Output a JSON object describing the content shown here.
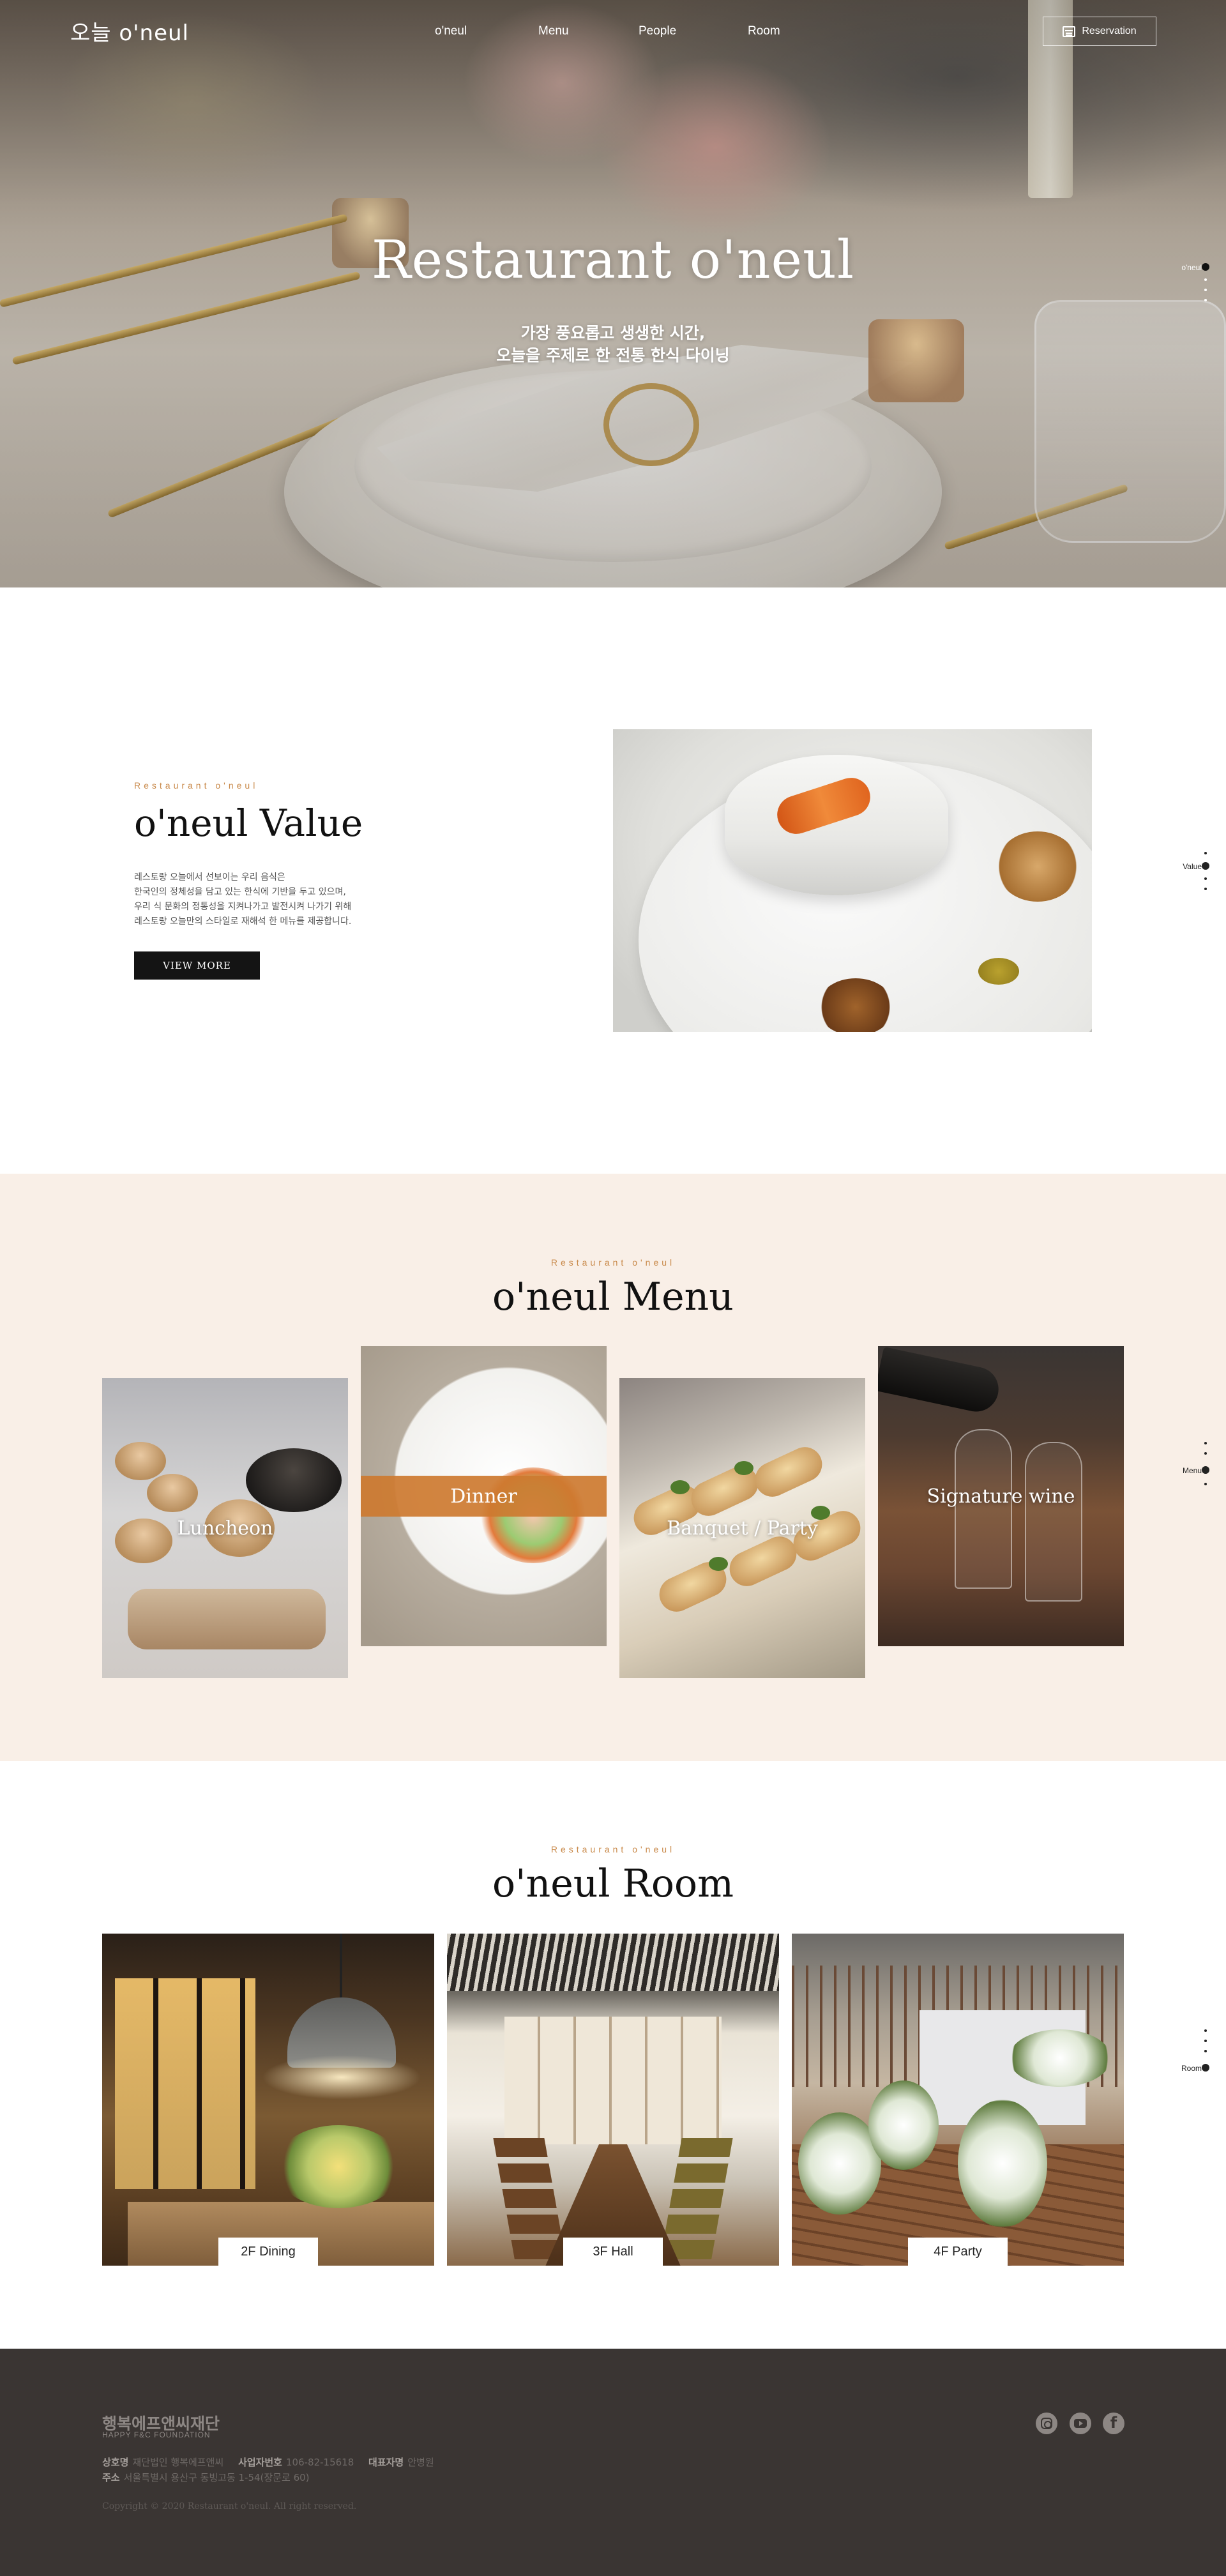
{
  "header": {
    "logo": "오늘 o'neul",
    "nav": [
      "o'neul",
      "Menu",
      "People",
      "Room"
    ],
    "reservation_label": "Reservation"
  },
  "hero": {
    "title": "Restaurant o'neul",
    "subtitle_line1": "가장 풍요롭고 생생한 시간,",
    "subtitle_line2": "오늘을 주제로 한 전통 한식 다이닝"
  },
  "side_nav": {
    "hero_label": "o'neul",
    "value_label": "Value",
    "menu_label": "Menu",
    "room_label": "Room"
  },
  "value": {
    "eyebrow": "Restaurant o'neul",
    "title": "o'neul Value",
    "body": [
      "레스토랑 오늘에서 선보이는 우리 음식은",
      "한국인의 정체성을 담고 있는 한식에 기반을 두고 있으며,",
      "우리 식 문화의 정통성을 지켜나가고 발전시켜 나가기 위해",
      "레스토랑 오늘만의 스타일로 재해석 한 메뉴를 제공합니다."
    ],
    "button_label": "VIEW MORE"
  },
  "menu": {
    "eyebrow": "Restaurant o'neul",
    "title": "o'neul Menu",
    "cards": [
      {
        "label": "Luncheon"
      },
      {
        "label": "Dinner"
      },
      {
        "label": "Banquet / Party"
      },
      {
        "label": "Signature wine"
      }
    ],
    "accent_color": "#cd7a30",
    "background_color": "#f9efe7"
  },
  "room": {
    "eyebrow": "Restaurant o'neul",
    "title": "o'neul Room",
    "cards": [
      {
        "label": "2F Dining"
      },
      {
        "label": "3F Hall"
      },
      {
        "label": "4F Party"
      }
    ]
  },
  "footer": {
    "logo": "행복에프앤씨재단",
    "logo_en": "HAPPY F&C FOUNDATION",
    "row1": {
      "company_label": "상호명",
      "company_value": "재단법인 행복에프앤씨",
      "bizno_label": "사업자번호",
      "bizno_value": "106-82-15618",
      "ceo_label": "대표자명",
      "ceo_value": "안병원"
    },
    "row2": {
      "address_label": "주소",
      "address_value": "서울특별시 용산구 동빙고동 1-54(장문로 60)"
    },
    "copyright": "Copyright © 2020 Restaurant o'neul. All right reserved.",
    "social_icons": [
      "instagram-icon",
      "youtube-icon",
      "facebook-icon"
    ],
    "background_color": "#3a3533"
  }
}
